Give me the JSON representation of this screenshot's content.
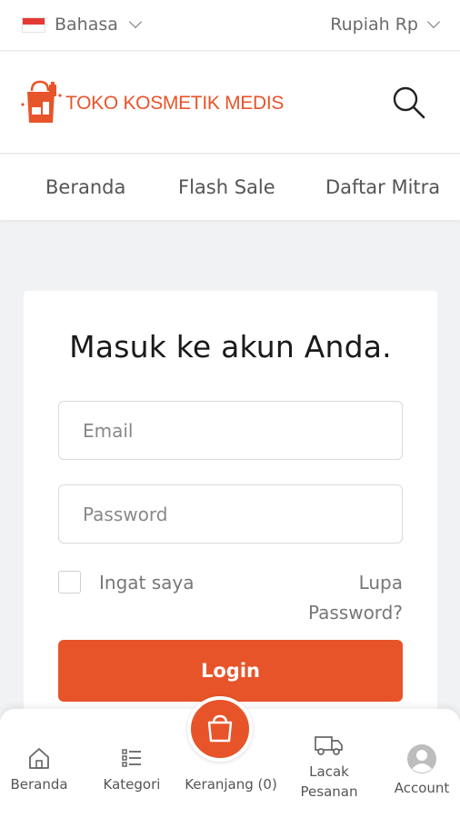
{
  "topbar": {
    "language_label": "Bahasa",
    "currency_label": "Rupiah Rp"
  },
  "header": {
    "logo_text": "TOKO KOSMETIK MEDIS"
  },
  "nav": {
    "items": [
      {
        "label": "Beranda"
      },
      {
        "label": "Flash Sale"
      },
      {
        "label": "Daftar Mitra"
      }
    ]
  },
  "login": {
    "title": "Masuk ke akun Anda.",
    "email_placeholder": "Email",
    "password_placeholder": "Password",
    "remember_label": "Ingat saya",
    "forgot_label": "Lupa Password?",
    "login_label": "Login"
  },
  "bottom_nav": {
    "items": [
      {
        "label": "Beranda",
        "icon": "home-icon"
      },
      {
        "label": "Kategori",
        "icon": "list-icon"
      },
      {
        "label": "Keranjang (0)",
        "icon": "shopping-bag-icon"
      },
      {
        "label": "Lacak Pesanan",
        "icon": "truck-icon"
      },
      {
        "label": "Account",
        "icon": "avatar-icon"
      }
    ]
  },
  "colors": {
    "accent": "#e8542a",
    "background": "#f1f2f4"
  }
}
